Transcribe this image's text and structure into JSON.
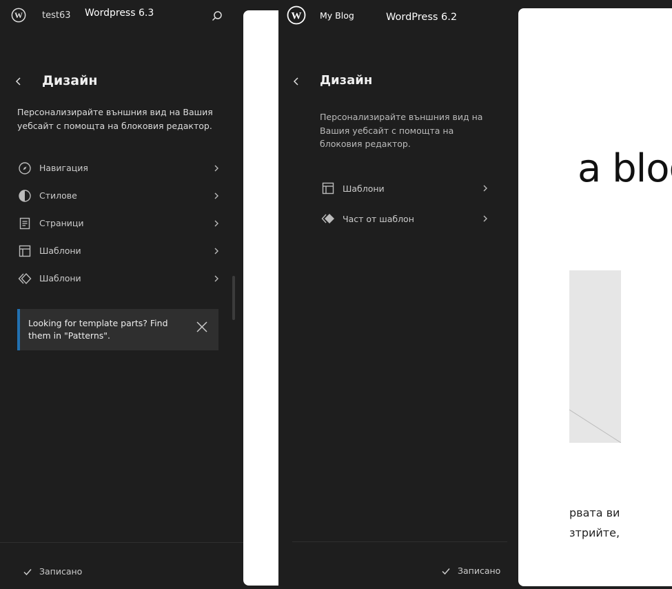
{
  "left_panel": {
    "site_name": "test63",
    "app_title": "Wordpress 6.3",
    "heading": "Дизайн",
    "description": "Персонализирайте външния вид на Вашия уебсайт с помощта на блоковия редактор.",
    "nav_items": [
      {
        "label": "Навигация",
        "icon": "navigation-icon"
      },
      {
        "label": "Стилове",
        "icon": "styles-icon"
      },
      {
        "label": "Страници",
        "icon": "pages-icon"
      },
      {
        "label": "Шаблони",
        "icon": "templates-icon"
      },
      {
        "label": "Шаблони",
        "icon": "patterns-icon"
      }
    ],
    "notice": "Looking for template parts? Find them in \"Patterns\".",
    "status": "Записано"
  },
  "right_panel": {
    "site_name": "My Blog",
    "app_title": "WordPress 6.2",
    "heading": "Дизайн",
    "description": "Персонализирайте външния вид на Вашия уебсайт с помощта на блоковия редактор.",
    "nav_items": [
      {
        "label": "Шаблони",
        "icon": "templates-icon"
      },
      {
        "label": "Част от шаблон",
        "icon": "template-part-icon"
      }
    ],
    "status": "Записано"
  },
  "preview": {
    "title_fragment": "a blog",
    "text_line_1": "рвата ви",
    "text_line_2": "зтрийте,"
  },
  "colors": {
    "background": "#1e1e1e",
    "notice_accent": "#2271b1",
    "text": "#e0e0e0"
  }
}
